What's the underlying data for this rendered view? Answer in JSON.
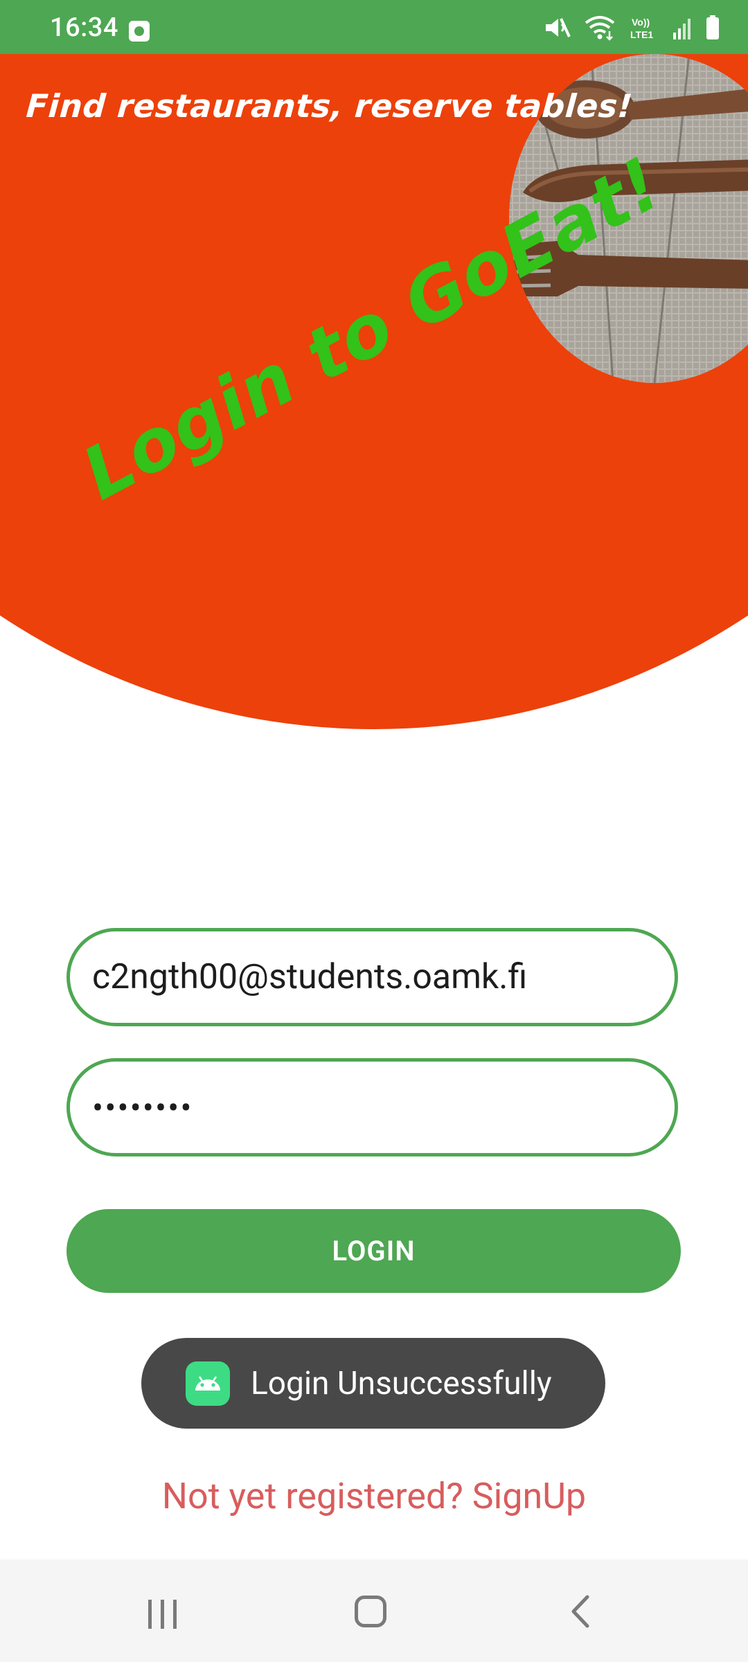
{
  "status_bar": {
    "time": "16:34",
    "icons": [
      "alarm-icon",
      "mute-icon",
      "wifi-icon",
      "volte-icon",
      "signal-icon",
      "battery-icon"
    ],
    "volte_text": "Vo)) LTE1"
  },
  "hero": {
    "tagline": "Find restaurants, reserve tables!",
    "heading": "Login to GoEat!"
  },
  "form": {
    "email_value": "c2ngth00@students.oamk.fi",
    "password_value": "••••••••",
    "login_label": "LOGIN"
  },
  "toast": {
    "message": "Login Unsuccessfully"
  },
  "signup_link": "Not yet registered? SignUp",
  "colors": {
    "primary_green": "#4ea752",
    "hero_orange": "#ec410b",
    "heading_green": "#32c219",
    "link_red": "#d85d5d",
    "toast_bg": "#484848"
  }
}
